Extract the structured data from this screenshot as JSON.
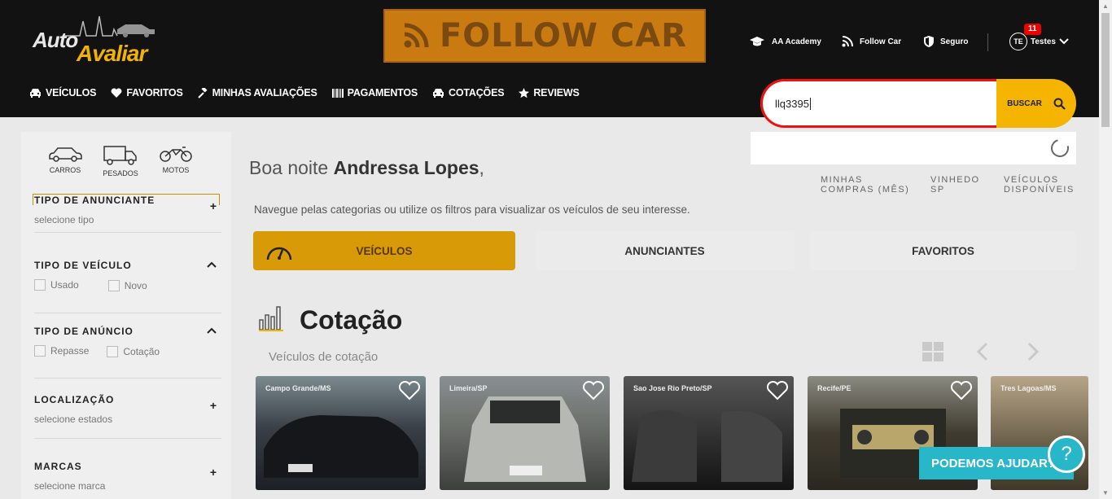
{
  "header": {
    "logo_top": "Auto",
    "logo_bottom": "Avaliar",
    "banner_text": "FOLLOW CAR",
    "top_links": [
      {
        "label": "AA Academy",
        "icon": "graduation-cap-icon"
      },
      {
        "label": "Follow Car",
        "icon": "rss-icon"
      },
      {
        "label": "Seguro",
        "icon": "shield-icon"
      }
    ],
    "user": {
      "initials": "TE",
      "name": "Testes",
      "notifications": "11"
    }
  },
  "nav": [
    {
      "label": "VEÍCULOS",
      "icon": "car-icon"
    },
    {
      "label": "FAVORITOS",
      "icon": "heart-icon"
    },
    {
      "label": "MINHAS AVALIAÇÕES",
      "icon": "gavel-icon"
    },
    {
      "label": "PAGAMENTOS",
      "icon": "barcode-icon"
    },
    {
      "label": "COTAÇÕES",
      "icon": "car-icon"
    },
    {
      "label": "REVIEWS",
      "icon": "star-icon"
    }
  ],
  "search": {
    "value": "llq3395",
    "button": "BUSCAR"
  },
  "sidebar": {
    "vehicle_types": [
      "CARROS",
      "PESADOS",
      "MOTOS"
    ],
    "filters": [
      {
        "title": "TIPO DE ANUNCIANTE",
        "sub": "selecione tipo",
        "toggle": "+"
      },
      {
        "title": "TIPO DE VEÍCULO",
        "options": [
          "Usado",
          "Novo"
        ],
        "toggle": "⌃"
      },
      {
        "title": "TIPO DE ANÚNCIO",
        "options": [
          "Repasse",
          "Cotação"
        ],
        "toggle": "⌃"
      },
      {
        "title": "LOCALIZAÇÃO",
        "sub": "selecione estados",
        "toggle": "+"
      },
      {
        "title": "MARCAS",
        "sub": "selecione marca",
        "toggle": "+"
      }
    ]
  },
  "main": {
    "greeting_prefix": "Boa noite",
    "greeting_name": "Andressa Lopes",
    "greeting_suffix": ",",
    "subtitle": "Navegue pelas categorias ou utilize os filtros para visualizar os veículos de seu interesse.",
    "stats": [
      {
        "line1": "MINHAS",
        "line2": "COMPRAS (MÊS)"
      },
      {
        "line1": "VINHEDO",
        "line2": "SP"
      },
      {
        "line1": "VEÍCULOS",
        "line2": "DISPONÍVEIS"
      }
    ],
    "tabs": [
      "VEÍCULOS",
      "ANUNCIANTES",
      "FAVORITOS"
    ],
    "section_title": "Cotação",
    "section_subtitle": "Veículos de cotação",
    "cards": [
      {
        "location": "Campo Grande/MS",
        "color": "#3a4048"
      },
      {
        "location": "Limeira/SP",
        "color": "#6b6f6a"
      },
      {
        "location": "Sao Jose Rio Preto/SP",
        "color": "#2c2c2c"
      },
      {
        "location": "Recife/PE",
        "color": "#3f3b30"
      },
      {
        "location": "Tres Lagoas/MS",
        "color": "#6a5e48"
      }
    ]
  },
  "help": {
    "label": "PODEMOS AJUDAR?"
  }
}
